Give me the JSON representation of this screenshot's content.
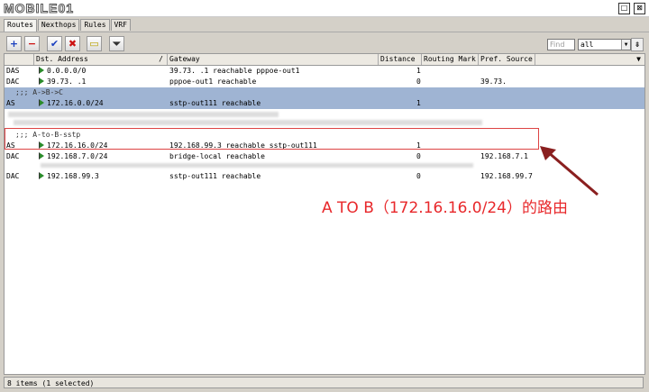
{
  "window": {
    "logo": "MOBILE01",
    "buttons": [
      "□",
      "⊠"
    ]
  },
  "tabs": [
    "Routes",
    "Nexthops",
    "Rules",
    "VRF"
  ],
  "toolbar": {
    "add_icon": "plus-icon",
    "remove_icon": "minus-icon",
    "enable_icon": "check-icon",
    "disable_icon": "x-icon",
    "comment_icon": "note-icon",
    "filter_icon": "filter-icon",
    "find_placeholder": "Find",
    "filter_value": "all"
  },
  "columns": [
    "",
    "Dst. Address",
    "Gateway",
    "Distance",
    "Routing Mark",
    "Pref. Source"
  ],
  "rows": [
    {
      "type": "route",
      "flags": "DAS",
      "dst": "0.0.0.0/0",
      "gateway": "39.73.      .1 reachable pppoe-out1",
      "distance": "1",
      "mark": "",
      "pref": ""
    },
    {
      "type": "route",
      "flags": "DAC",
      "dst": "39.73.      .1",
      "gateway": "pppoe-out1 reachable",
      "distance": "0",
      "mark": "",
      "pref": "39.73."
    },
    {
      "type": "comment",
      "text": ";;; A->B->C",
      "selected": true
    },
    {
      "type": "route",
      "flags": "AS",
      "dst": "172.16.0.0/24",
      "gateway": "sstp-out111 reachable",
      "distance": "1",
      "mark": "",
      "pref": "",
      "selected": true
    },
    {
      "type": "comment",
      "text": ";;; A-to-B-sstp"
    },
    {
      "type": "route",
      "flags": "AS",
      "dst": "172.16.16.0/24",
      "gateway": "192.168.99.3 reachable sstp-out111",
      "distance": "1",
      "mark": "",
      "pref": ""
    },
    {
      "type": "route",
      "flags": "DAC",
      "dst": "192.168.7.0/24",
      "gateway": "bridge-local reachable",
      "distance": "0",
      "mark": "",
      "pref": "192.168.7.1"
    },
    {
      "type": "route",
      "flags": "DAC",
      "dst": "192.168.99.3",
      "gateway": "sstp-out111 reachable",
      "distance": "0",
      "mark": "",
      "pref": "192.168.99.7"
    }
  ],
  "annotation": "A TO B（172.16.16.0/24）的路由",
  "status": "8 items (1 selected)"
}
